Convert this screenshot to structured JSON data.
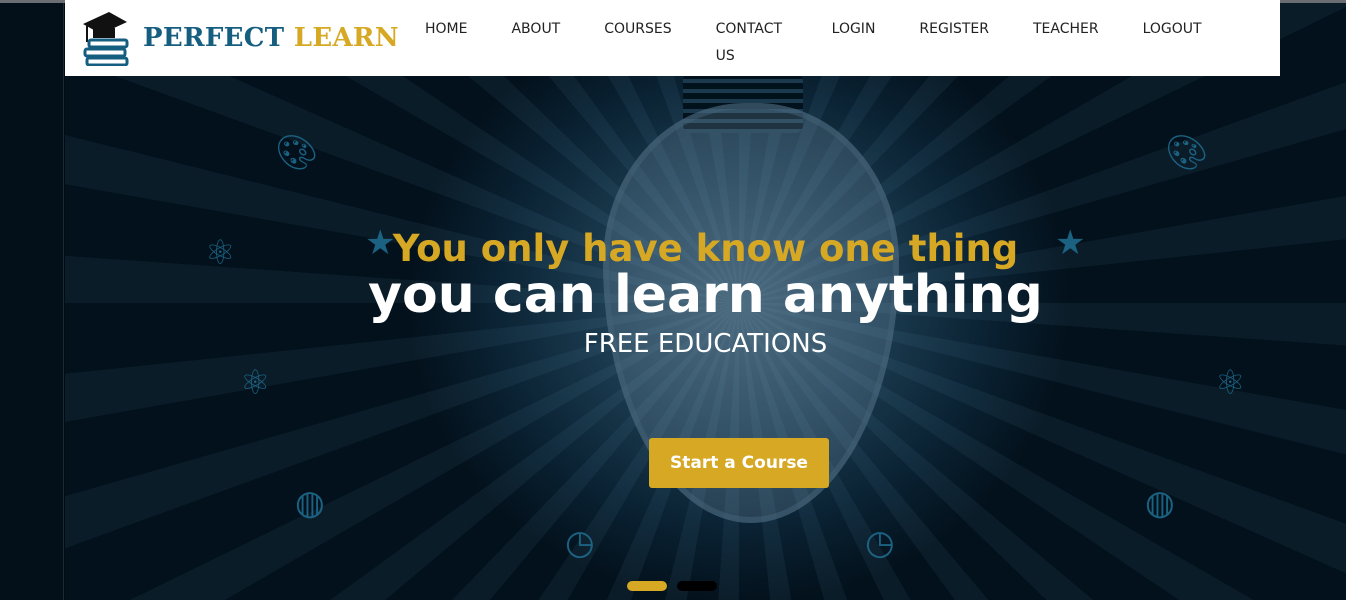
{
  "brand": {
    "part1": "PERFECT",
    "part2": "LEARN",
    "primary_color": "#155e80",
    "accent_color": "#d6a824"
  },
  "nav": [
    "HOME",
    "ABOUT",
    "COURSES",
    "CONTACT US",
    "LOGIN",
    "REGISTER",
    "TEACHER",
    "LOGOUT"
  ],
  "hero": {
    "line1": "You only have know one thing",
    "line2": "you can learn anything",
    "line3": "FREE EDUCATIONS",
    "button": "Start a Course",
    "slides": 2,
    "active_slide": 1
  }
}
